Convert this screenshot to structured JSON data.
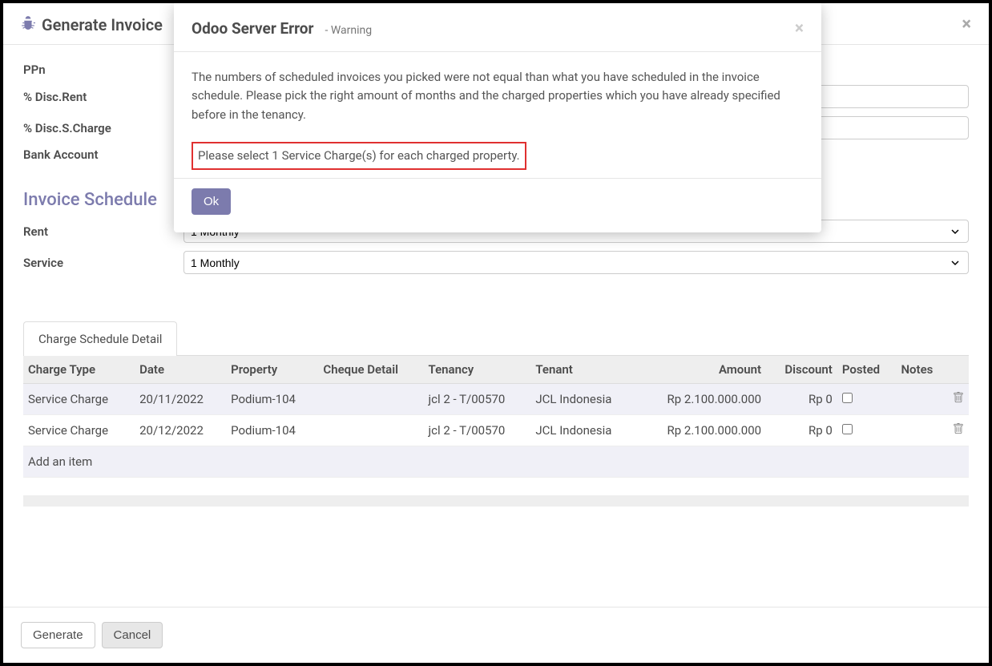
{
  "page": {
    "title": "Generate Invoice"
  },
  "fields": {
    "ppn_label": "PPn",
    "disc_rent_label": "% Disc.Rent",
    "disc_scharge_label": "% Disc.S.Charge",
    "bank_account_label": "Bank Account",
    "disc_rent_value": "",
    "disc_scharge_value": ""
  },
  "schedule": {
    "title": "Invoice Schedule",
    "rent_label": "Rent",
    "service_label": "Service",
    "rent_value": "1 Monthly",
    "service_value": "1 Monthly"
  },
  "tab": {
    "label": "Charge Schedule Detail"
  },
  "table": {
    "headers": {
      "charge_type": "Charge Type",
      "date": "Date",
      "property": "Property",
      "cheque": "Cheque Detail",
      "tenancy": "Tenancy",
      "tenant": "Tenant",
      "amount": "Amount",
      "discount": "Discount",
      "posted": "Posted",
      "notes": "Notes"
    },
    "rows": [
      {
        "charge_type": "Service Charge",
        "date": "20/11/2022",
        "property": "Podium-104",
        "cheque": "",
        "tenancy": "jcl 2 - T/00570",
        "tenant": "JCL Indonesia",
        "amount": "Rp 2.100.000.000",
        "discount": "Rp 0",
        "posted": false,
        "notes": ""
      },
      {
        "charge_type": "Service Charge",
        "date": "20/12/2022",
        "property": "Podium-104",
        "cheque": "",
        "tenancy": "jcl 2 - T/00570",
        "tenant": "JCL Indonesia",
        "amount": "Rp 2.100.000.000",
        "discount": "Rp 0",
        "posted": false,
        "notes": ""
      }
    ],
    "add_item": "Add an item"
  },
  "footer": {
    "generate": "Generate",
    "cancel": "Cancel"
  },
  "modal": {
    "title": "Odoo Server Error",
    "subtitle": "- Warning",
    "message": "The numbers of scheduled invoices you picked were not equal than what you have scheduled in the invoice schedule. Please pick the right amount of months and the charged properties which you have already specified before in the tenancy.",
    "highlight": "Please select 1 Service Charge(s) for each charged property.",
    "ok": "Ok"
  }
}
